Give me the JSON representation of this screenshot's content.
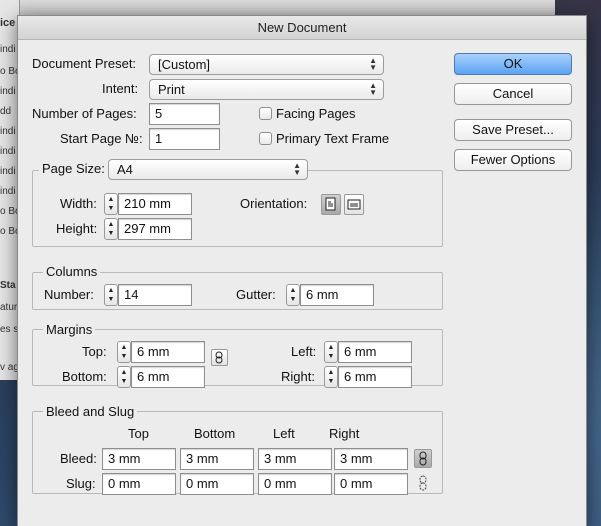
{
  "background": {
    "rows": [
      "ice",
      "indi",
      "o Bo",
      "indi",
      "dd",
      "indi",
      "indi",
      "indi",
      "indi",
      "o Bo",
      "o Bo",
      "Sta",
      "atur",
      "es s",
      "v ag"
    ]
  },
  "dialog": {
    "title": "New Document",
    "document_preset": {
      "label": "Document Preset:",
      "value": "[Custom]"
    },
    "intent": {
      "label": "Intent:",
      "value": "Print"
    },
    "number_of_pages": {
      "label": "Number of Pages:",
      "value": "5"
    },
    "start_page": {
      "label": "Start Page №:",
      "value": "1"
    },
    "facing_pages": {
      "label": "Facing Pages",
      "checked": false
    },
    "primary_text_frame": {
      "label": "Primary Text Frame",
      "checked": false
    },
    "buttons": {
      "ok": "OK",
      "cancel": "Cancel",
      "save_preset": "Save Preset...",
      "fewer_options": "Fewer Options"
    },
    "page_size": {
      "label": "Page Size:",
      "value": "A4",
      "width_label": "Width:",
      "width": "210 mm",
      "height_label": "Height:",
      "height": "297 mm",
      "orientation_label": "Orientation:",
      "orientation": "portrait"
    },
    "columns": {
      "title": "Columns",
      "number_label": "Number:",
      "number": "14",
      "gutter_label": "Gutter:",
      "gutter": "6 mm"
    },
    "margins": {
      "title": "Margins",
      "top_label": "Top:",
      "top": "6 mm",
      "bottom_label": "Bottom:",
      "bottom": "6 mm",
      "left_label": "Left:",
      "left": "6 mm",
      "right_label": "Right:",
      "right": "6 mm",
      "linked": false
    },
    "bleed_slug": {
      "title": "Bleed and Slug",
      "headers": [
        "Top",
        "Bottom",
        "Left",
        "Right"
      ],
      "bleed_label": "Bleed:",
      "bleed": [
        "3 mm",
        "3 mm",
        "3 mm",
        "3 mm"
      ],
      "slug_label": "Slug:",
      "slug": [
        "0 mm",
        "0 mm",
        "0 mm",
        "0 mm"
      ]
    },
    "accent_color": "#5aa2f2"
  }
}
